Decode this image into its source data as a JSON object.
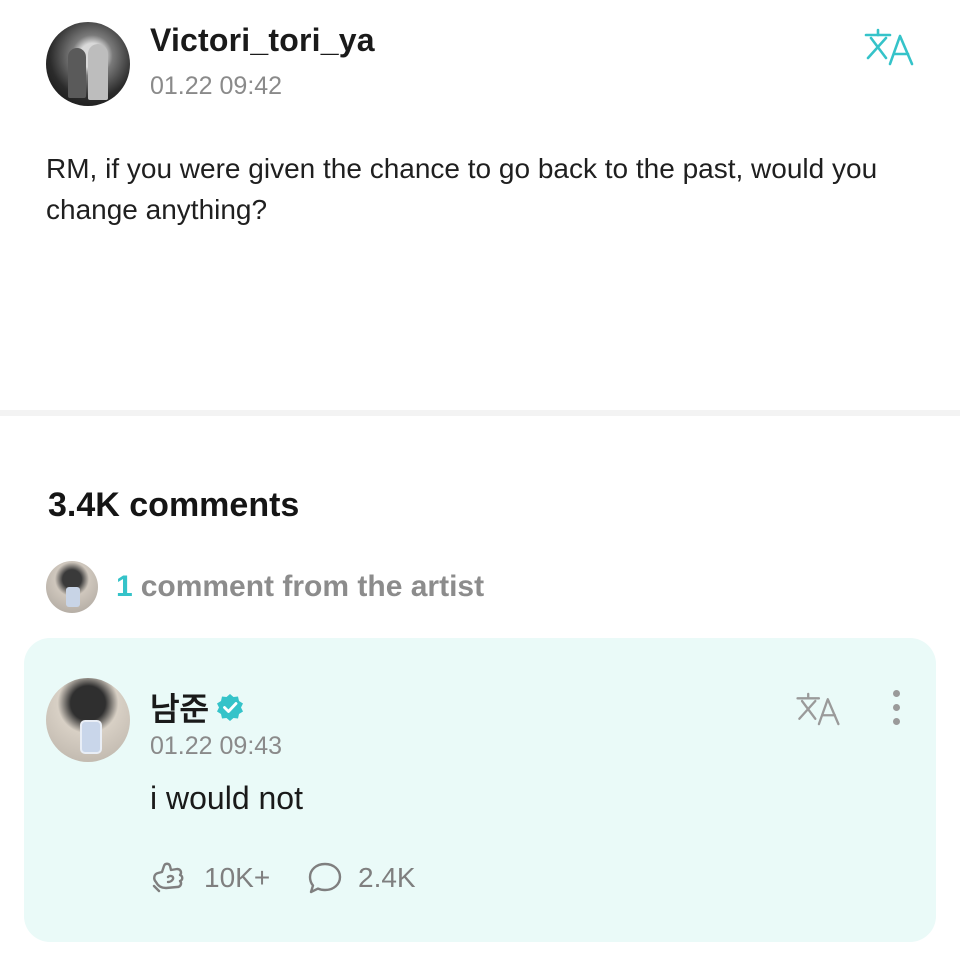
{
  "post": {
    "author": "Victori_tori_ya",
    "time": "01.22 09:42",
    "body": "RM, if you were given the chance to go back to the past, would you change anything?",
    "translate_icon": "translate-icon"
  },
  "comments": {
    "count_label": "3.4K comments",
    "artist_summary": {
      "count": "1",
      "label": "comment from the artist"
    }
  },
  "artist_comment": {
    "author": "남준",
    "verified_icon": "verified-badge-icon",
    "time": "01.22 09:43",
    "body": "i would not",
    "likes": "10K+",
    "replies": "2.4K",
    "icons": [
      "translate-icon",
      "more-vertical-icon",
      "like-icon",
      "reply-icon"
    ]
  },
  "colors": {
    "accent": "#35c3c9",
    "card_bg": "#eafaf8",
    "muted_text": "#8a8a8a"
  }
}
